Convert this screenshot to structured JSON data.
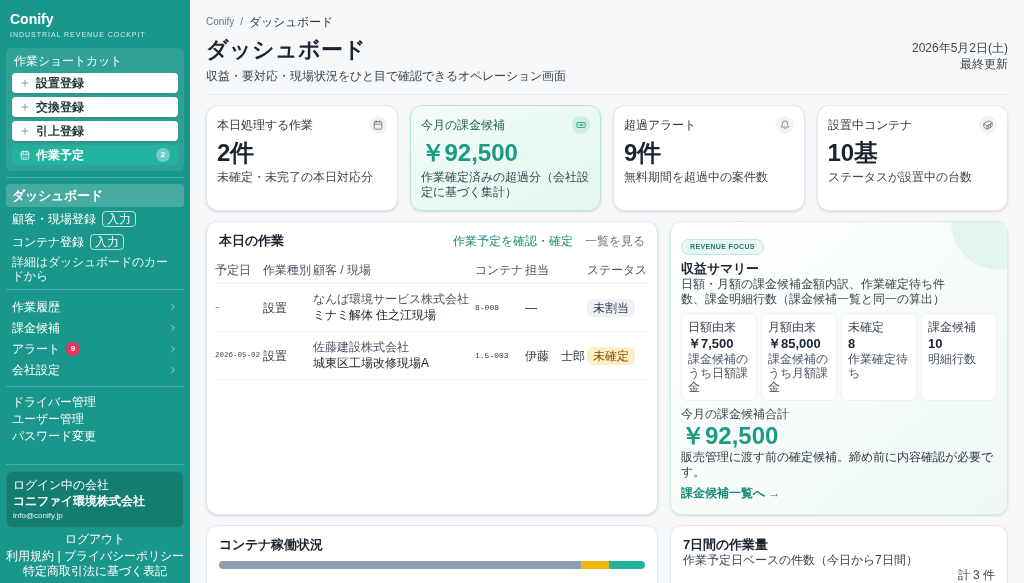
{
  "sidebar": {
    "brand": "Conify",
    "tagline": "INDUSTRIAL REVENUE COCKPIT",
    "shortcuts": {
      "label": "作業ショートカット",
      "items": [
        {
          "kind": "add",
          "label": "設置登録"
        },
        {
          "kind": "add",
          "label": "交換登録"
        },
        {
          "kind": "add",
          "label": "引上登録"
        },
        {
          "kind": "schedule",
          "label": "作業予定",
          "count": "2"
        }
      ]
    },
    "main_nav": [
      {
        "label": "ダッシュボード",
        "selected": true
      },
      {
        "label": "顧客・現場登録",
        "selected": false,
        "badge": "入力"
      },
      {
        "label": "コンテナ登録",
        "selected": false,
        "badge": "入力"
      }
    ],
    "nav_hint": "詳細はダッシュボードのカードから",
    "nav": [
      {
        "label": "作業履歴",
        "selected": false
      },
      {
        "label": "課金候補",
        "selected": false
      },
      {
        "label": "アラート",
        "selected": false,
        "count": "9"
      },
      {
        "label": "会社設定",
        "selected": false
      }
    ],
    "settings_links": [
      "ドライバー管理",
      "ユーザー管理",
      "パスワード変更"
    ],
    "account": {
      "label": "ログイン中の会社",
      "company": "コニファイ環境株式会社",
      "email": "info@conify.jp"
    },
    "logout": "ログアウト",
    "footer": {
      "line_1": {
        "left": "利用規約",
        "separator": "|",
        "right": "プライバシーポリシー"
      },
      "line_2": "特定商取引法に基づく表記"
    }
  },
  "breadcrumb": {
    "items": [
      "Conify",
      "ダッシュボード"
    ],
    "separator": "/"
  },
  "header": {
    "title": "ダッシュボード",
    "subtitle": "収益・要対応・現場状況をひと目で確認できるオペレーション画面",
    "date": "2026年5月2日(土)",
    "updated_label": "最終更新"
  },
  "stats": [
    {
      "label": "本日処理する作業",
      "value": "2件",
      "note": "未確定・未完了の本日対応分",
      "highlighted": false
    },
    {
      "label": "今月の課金候補",
      "value": "￥92,500",
      "note": "作業確定済みの超過分（会社設定に基づく集計）",
      "highlighted": true
    },
    {
      "label": "超過アラート",
      "value": "9件",
      "note": "無料期間を超過中の案件数",
      "highlighted": false
    },
    {
      "label": "設置中コンテナ",
      "value": "10基",
      "note": "ステータスが設置中の台数",
      "highlighted": false
    }
  ],
  "today_jobs": {
    "title": "本日の作業",
    "links": [
      {
        "kind": "primary",
        "text": "作業予定を確認・確定"
      },
      {
        "kind": "muted",
        "text": "一覧を見る"
      }
    ],
    "columns": [
      "予定日",
      "作業種別",
      "顧客 / 現場",
      "コンテナ",
      "担当",
      "ステータス"
    ],
    "rows": [
      {
        "date": "–",
        "type": "設置",
        "customer": "なんば環境サービス株式会社",
        "site": "ミナミ解体 住之江現場",
        "container": "8-008",
        "assignee": "—",
        "status": {
          "kind": "unassigned",
          "label": "未割当"
        }
      },
      {
        "date": "2026-05-02",
        "type": "設置",
        "customer": "佐藤建設株式会社",
        "site": "城東区工場改修現場A",
        "container": "1.5-003",
        "assignee": "伊藤　士郎",
        "status": {
          "kind": "unconfirmed",
          "label": "未確定"
        }
      }
    ]
  },
  "revenue": {
    "tag": "REVENUE FOCUS",
    "title": "収益サマリー",
    "description": "日額・月額の課金候補金額内訳、作業確定待ち件数、課金明細行数（課金候補一覧と同一の算出）",
    "metrics": [
      {
        "label": "日額由来",
        "value": "￥7,500",
        "note": "課金候補のうち日額課金"
      },
      {
        "label": "月額由来",
        "value": "￥85,000",
        "note": "課金候補のうち月額課金"
      },
      {
        "label": "未確定",
        "value": "8",
        "note": "作業確定待ち"
      },
      {
        "label": "課金候補",
        "value": "10",
        "note": "明細行数"
      }
    ],
    "total_label": "今月の課金候補合計",
    "total": "￥92,500",
    "note": "販売管理に渡す前の確定候補。締め前に内容確認が必要です。",
    "link": "課金候補一覧へ →"
  },
  "container_status": {
    "title": "コンテナ稼働状況"
  },
  "weekly": {
    "title": "7日間の作業量",
    "subtitle": "作業予定日ベースの件数（今日から7日間）",
    "total": "計 3 件"
  }
}
